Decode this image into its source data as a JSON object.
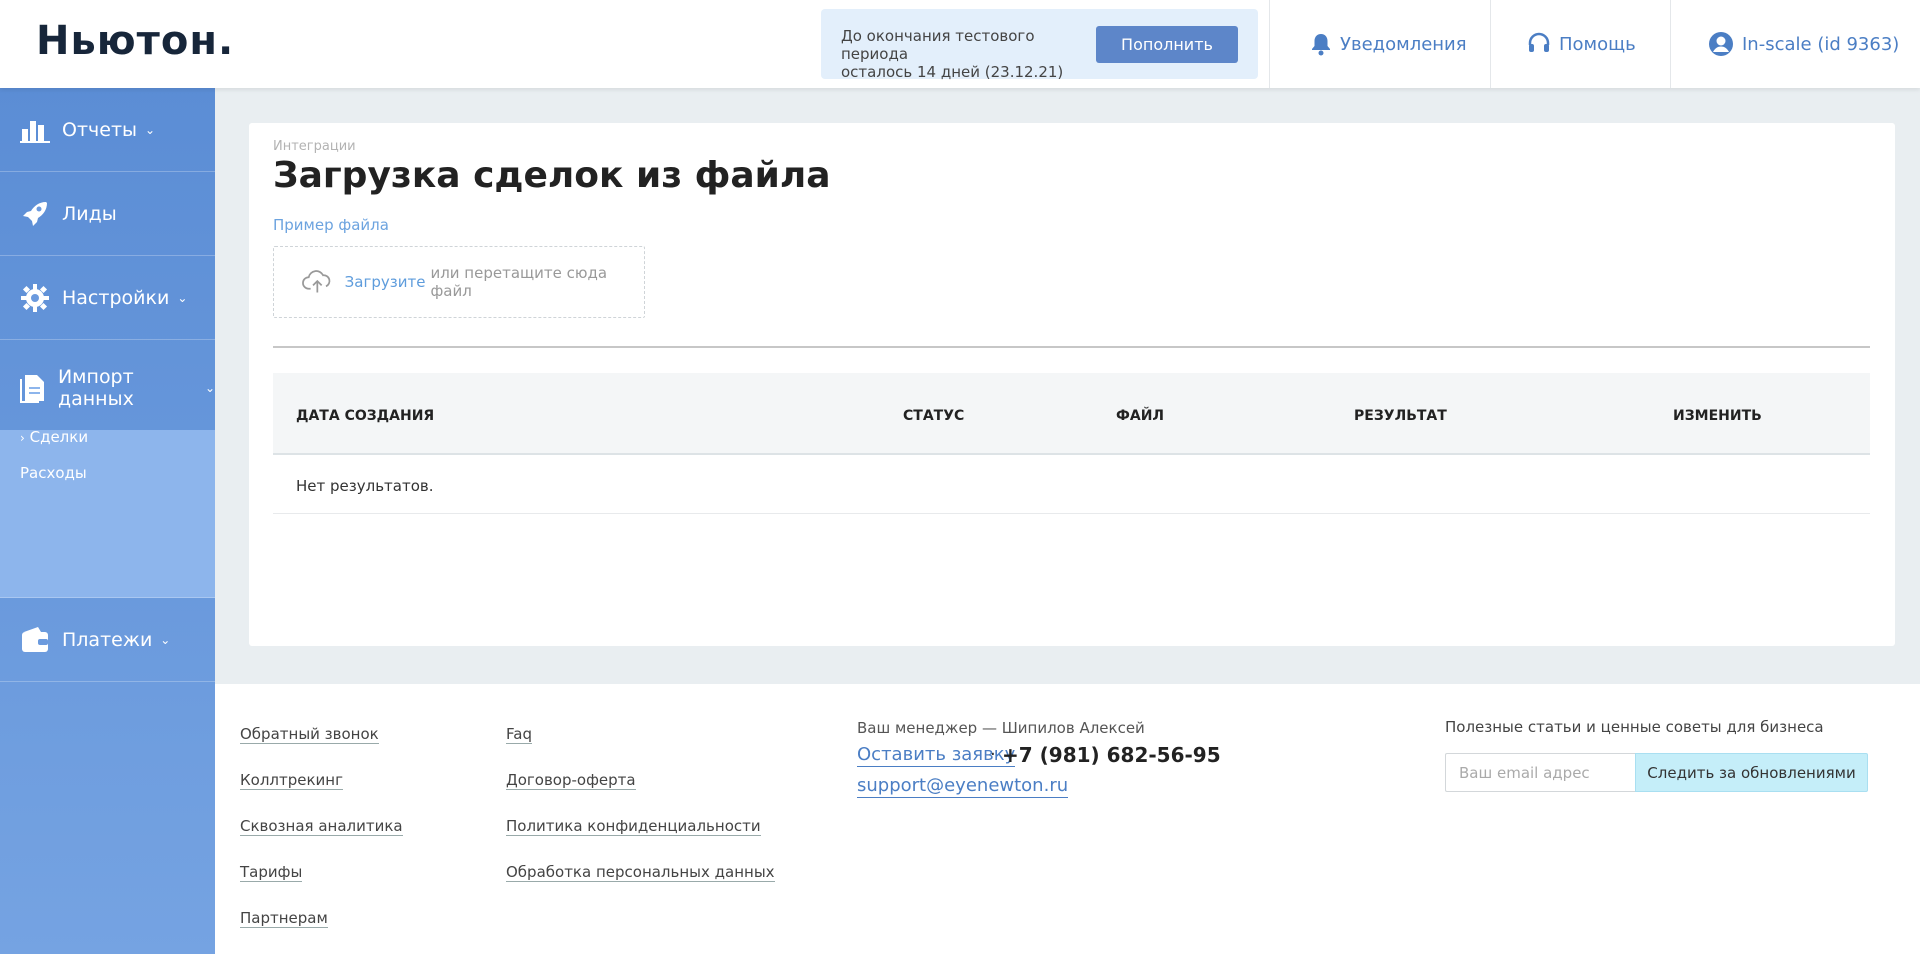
{
  "header": {
    "logo": "Ньютон.",
    "trial": {
      "text_line1": "До окончания тестового периода",
      "text_line2": "осталось 14 дней (23.12.21)",
      "topup_label": "Пополнить"
    },
    "notifications_label": "Уведомления",
    "help_label": "Помощь",
    "account_label": "In-scale (id 9363)"
  },
  "sidebar": {
    "items": [
      {
        "label": "Отчеты",
        "icon": "chart-icon"
      },
      {
        "label": "Лиды",
        "icon": "rocket-icon"
      },
      {
        "label": "Настройки",
        "icon": "gear-icon"
      },
      {
        "label": "Импорт данных",
        "icon": "document-icon"
      },
      {
        "label": "Платежи",
        "icon": "wallet-icon"
      }
    ],
    "import_sub": [
      "Сделки",
      "Расходы"
    ]
  },
  "main": {
    "breadcrumb": "Интеграции",
    "title": "Загрузка сделок из файла",
    "sample_link": "Пример файла",
    "upload_link": "Загрузите",
    "upload_rest": "или перетащите сюда файл",
    "table": {
      "columns": [
        "ДАТА СОЗДАНИЯ",
        "СТАТУС",
        "ФАЙЛ",
        "РЕЗУЛЬТАТ",
        "ИЗМЕНИТЬ"
      ],
      "empty_text": "Нет результатов."
    }
  },
  "footer": {
    "col1": [
      "Обратный звонок",
      "Коллтрекинг",
      "Сквозная аналитика",
      "Тарифы",
      "Партнерам"
    ],
    "col2": [
      "Faq",
      "Договор-оферта",
      "Политика конфиденциальности",
      "Обработка персональных данных"
    ],
    "manager": "Ваш менеджер — Шипилов Алексей",
    "request_link": "Оставить заявку",
    "separator": "·",
    "phone": "+7 (981) 682-56-95",
    "email": "support@eyenewton.ru",
    "newsletter_title": "Полезные статьи и ценные советы для бизнеса",
    "email_placeholder": "Ваш email адрес",
    "subscribe_label": "Следить за обновлениями"
  },
  "colors": {
    "accent": "#4b7ec4",
    "sidebar": "#5b8dd5",
    "sidebar_active": "#8db5ec",
    "button": "#5d86c9"
  }
}
